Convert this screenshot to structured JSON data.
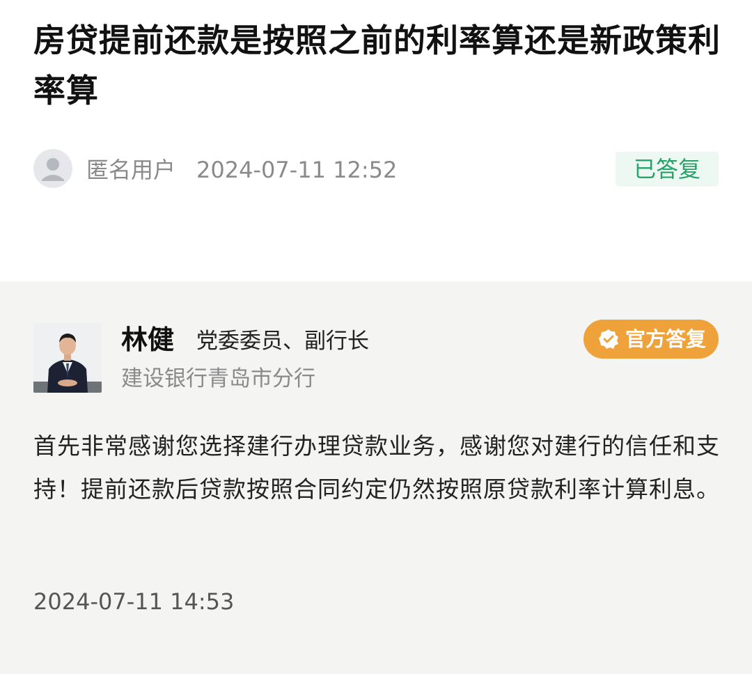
{
  "question": {
    "title": "房贷提前还款是按照之前的利率算还是新政策利率算",
    "asker_avatar_icon": "user-icon",
    "asker_name": "匿名用户",
    "asked_time": "2024-07-11 12:52",
    "status": "已答复"
  },
  "answer": {
    "responder_name": "林健",
    "responder_title": "党委委员、副行长",
    "responder_org": "建设银行青岛市分行",
    "badge_icon": "verified-check-icon",
    "badge_label": "官方答复",
    "body": "首先非常感谢您选择建行办理贷款业务，感谢您对建行的信任和支持！提前还款后贷款按照合同约定仍然按照原贷款利率计算利息。",
    "answered_time": "2024-07-11 14:53"
  },
  "colors": {
    "status_green": "#27a36a",
    "status_bg": "#eef8f3",
    "badge_orange": "#f0a23a",
    "answer_bg": "#f4f4f2"
  }
}
